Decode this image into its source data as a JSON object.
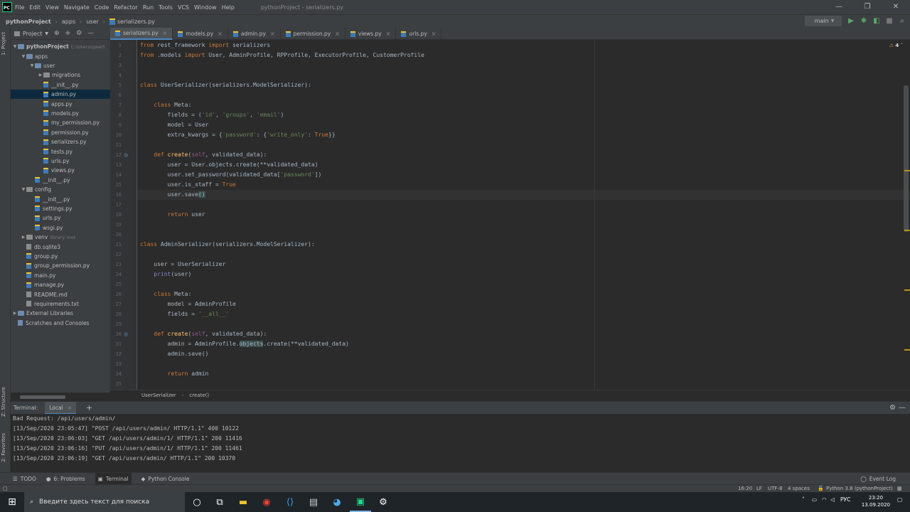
{
  "window": {
    "title": "pythonProject - serializers.py",
    "menu": [
      "File",
      "Edit",
      "View",
      "Navigate",
      "Code",
      "Refactor",
      "Run",
      "Tools",
      "VCS",
      "Window",
      "Help"
    ],
    "controls": {
      "minimize": "—",
      "restore": "❐",
      "close": "✕"
    }
  },
  "navbar": {
    "crumbs": [
      "pythonProject",
      "apps",
      "user",
      "serializers.py"
    ],
    "branch": "main",
    "branch_icon": "python-icon"
  },
  "left_strip": {
    "project": "1: Project",
    "structure": "Z: Structure",
    "favorites": "2: Favorites"
  },
  "project_panel": {
    "title": "Project",
    "tree": [
      {
        "label": "pythonProject",
        "extra": "C:\\Users\\qwert",
        "type": "folder",
        "depth": 0,
        "open": true,
        "bold": true
      },
      {
        "label": "apps",
        "type": "folder",
        "depth": 1,
        "open": true
      },
      {
        "label": "user",
        "type": "folder",
        "depth": 2,
        "open": true
      },
      {
        "label": "migrations",
        "type": "folder",
        "depth": 3,
        "open": false
      },
      {
        "label": "__init__.py",
        "type": "py",
        "depth": 3
      },
      {
        "label": "admin.py",
        "type": "py",
        "depth": 3,
        "selected": true
      },
      {
        "label": "apps.py",
        "type": "py",
        "depth": 3
      },
      {
        "label": "models.py",
        "type": "py",
        "depth": 3
      },
      {
        "label": "my_permission.py",
        "type": "py",
        "depth": 3
      },
      {
        "label": "permission.py",
        "type": "py",
        "depth": 3
      },
      {
        "label": "serializers.py",
        "type": "py",
        "depth": 3
      },
      {
        "label": "tests.py",
        "type": "py",
        "depth": 3
      },
      {
        "label": "urls.py",
        "type": "py",
        "depth": 3
      },
      {
        "label": "views.py",
        "type": "py",
        "depth": 3
      },
      {
        "label": "__init__.py",
        "type": "py",
        "depth": 2
      },
      {
        "label": "config",
        "type": "folder",
        "depth": 1,
        "open": true
      },
      {
        "label": "__init__.py",
        "type": "py",
        "depth": 2
      },
      {
        "label": "settings.py",
        "type": "py",
        "depth": 2
      },
      {
        "label": "urls.py",
        "type": "py",
        "depth": 2
      },
      {
        "label": "wsgi.py",
        "type": "py",
        "depth": 2
      },
      {
        "label": "venv",
        "extra": "library root",
        "type": "folder",
        "depth": 1,
        "open": false,
        "venv": true
      },
      {
        "label": "db.sqlite3",
        "type": "file",
        "depth": 1
      },
      {
        "label": "group.py",
        "type": "py",
        "depth": 1
      },
      {
        "label": "group_permission.py",
        "type": "py",
        "depth": 1
      },
      {
        "label": "main.py",
        "type": "py",
        "depth": 1
      },
      {
        "label": "manage.py",
        "type": "py",
        "depth": 1
      },
      {
        "label": "README.md",
        "type": "file",
        "depth": 1
      },
      {
        "label": "requirements.txt",
        "type": "file",
        "depth": 1
      },
      {
        "label": "External Libraries",
        "type": "lib",
        "depth": 0,
        "open": false
      },
      {
        "label": "Scratches and Consoles",
        "type": "scratch",
        "depth": 0
      }
    ]
  },
  "tabs": [
    {
      "label": "serializers.py",
      "active": true
    },
    {
      "label": "models.py"
    },
    {
      "label": "admin.py"
    },
    {
      "label": "permission.py"
    },
    {
      "label": "views.py"
    },
    {
      "label": "urls.py"
    }
  ],
  "editor": {
    "warnings": "4",
    "lines": [
      {
        "n": "1",
        "html": "<span class=\"kw\">from</span> rest_framework <span class=\"kw\">import</span> serializers"
      },
      {
        "n": "2",
        "html": "<span class=\"kw\">from</span> .models <span class=\"kw\">import</span> User, AdminProfile, RPProfile, ExecutorProfile, CustomerProfile"
      },
      {
        "n": "3",
        "html": ""
      },
      {
        "n": "4",
        "html": ""
      },
      {
        "n": "5",
        "html": "<span class=\"kw\">class</span> UserSerializer(serializers.ModelSerializer):"
      },
      {
        "n": "6",
        "html": ""
      },
      {
        "n": "7",
        "html": "    <span class=\"kw\">class</span> Meta:"
      },
      {
        "n": "8",
        "html": "        fields = (<span class=\"st\">'id'</span>, <span class=\"st\">'groups'</span>, <span class=\"st\">'email'</span>)"
      },
      {
        "n": "9",
        "html": "        model = User"
      },
      {
        "n": "10",
        "html": "        extra_kwargs = {<span class=\"st\">'password'</span>: {<span class=\"st\">'write_only'</span>: <span class=\"kw\">True</span>}}"
      },
      {
        "n": "11",
        "html": ""
      },
      {
        "n": "12",
        "html": "    <span class=\"kw\">def</span> <span class=\"fn\">create</span>(<span class=\"sf\">self</span>, validated_data):"
      },
      {
        "n": "13",
        "html": "        user = User.objects.create(**validated_data)"
      },
      {
        "n": "14",
        "html": "        user.set_password(validated_data[<span class=\"st\">'password'</span>])"
      },
      {
        "n": "15",
        "html": "        user.is_staff = <span class=\"kw\">True</span>"
      },
      {
        "n": "16",
        "html": "        user.save<span class=\"match\">()</span>",
        "current": true
      },
      {
        "n": "17",
        "html": ""
      },
      {
        "n": "18",
        "html": "        <span class=\"kw\">return</span> user"
      },
      {
        "n": "19",
        "html": ""
      },
      {
        "n": "20",
        "html": ""
      },
      {
        "n": "21",
        "html": "<span class=\"kw\">class</span> AdminSerializer(serializers.ModelSerializer):"
      },
      {
        "n": "22",
        "html": ""
      },
      {
        "n": "23",
        "html": "    user = UserSerializer"
      },
      {
        "n": "24",
        "html": "    <span class=\"bi\">print</span>(user)"
      },
      {
        "n": "25",
        "html": ""
      },
      {
        "n": "26",
        "html": "    <span class=\"kw\">class</span> Meta:"
      },
      {
        "n": "27",
        "html": "        model = AdminProfile"
      },
      {
        "n": "28",
        "html": "        fields = <span class=\"st\">'__all__'</span>"
      },
      {
        "n": "29",
        "html": ""
      },
      {
        "n": "30",
        "html": "    <span class=\"kw\">def</span> <span class=\"fn\">create</span>(<span class=\"sf\">self</span>, validated_data):"
      },
      {
        "n": "31",
        "html": "        admin = AdminProfile.<span class=\"hl\">objects</span>.create(**validated_data)"
      },
      {
        "n": "32",
        "html": "        admin.save()"
      },
      {
        "n": "33",
        "html": ""
      },
      {
        "n": "34",
        "html": "        <span class=\"kw\">return</span> admin"
      },
      {
        "n": "35",
        "html": ""
      }
    ],
    "breadcrumb": [
      "UserSerializer",
      "create()"
    ]
  },
  "terminal": {
    "label": "Terminal:",
    "tab": "Local",
    "lines": [
      "Bad Request: /api/users/admin/",
      "[13/Sep/2020 23:05:47] \"POST /api/users/admin/ HTTP/1.1\" 400 10122",
      "[13/Sep/2020 23:06:03] \"GET /api/users/admin/1/ HTTP/1.1\" 200 11416",
      "[13/Sep/2020 23:06:16] \"PUT /api/users/admin/1/ HTTP/1.1\" 200 11461",
      "[13/Sep/2020 23:06:19] \"GET /api/users/admin/ HTTP/1.1\" 200 10370"
    ]
  },
  "tool_windows": {
    "todo": "TODO",
    "problems": "6: Problems",
    "terminal": "Terminal",
    "python_console": "Python Console",
    "event_log": "Event Log"
  },
  "status_bar": {
    "position": "16:20",
    "line_sep": "LF",
    "encoding": "UTF-8",
    "indent": "4 spaces",
    "interpreter": "Python 3.8 (pythonProject)"
  },
  "taskbar": {
    "search_placeholder": "Введите здесь текст для поиска",
    "lang": "РУС",
    "time": "23:20",
    "date": "13.09.2020"
  },
  "colors": {
    "accent": "#4a88c7",
    "keyword": "#cc7832",
    "string": "#6a8759",
    "function": "#ffc66d",
    "self": "#94558d"
  }
}
